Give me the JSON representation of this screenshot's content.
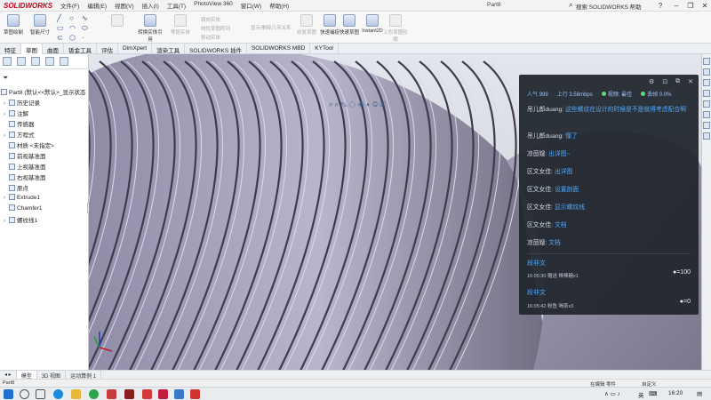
{
  "app": {
    "brand": "SOLIDWORKS",
    "title": "Part8",
    "help_search": "搜索 SOLIDWORKS 帮助",
    "menus": [
      "文件(F)",
      "编辑(E)",
      "视图(V)",
      "插入(I)",
      "工具(T)",
      "PhotoView 360",
      "窗口(W)",
      "帮助(H)"
    ]
  },
  "toolbar": {
    "sketch": "草图绘制",
    "smart_dim": "智能尺寸",
    "mirror": "镜向实体",
    "convert": "转换实体引用",
    "offset": "等距实体",
    "linear": "线性草图阵列",
    "move": "移动实体",
    "show": "显示/删除几何关系",
    "repair": "修复草图",
    "quick_snap": "快速捕捉",
    "rapid_sketch": "快速草图",
    "instant2d": "Instant2D",
    "shaded": "上色草图轮廓"
  },
  "command_tabs": [
    "特征",
    "草图",
    "曲面",
    "钣金工具",
    "评估",
    "DimXpert",
    "渲染工具",
    "SOLIDWORKS 插件",
    "SOLIDWORKS MBD",
    "KYTool"
  ],
  "tree": {
    "root": "Part8 (默认<<默认>_显示状态",
    "items": [
      "历史记录",
      "注解",
      "传感器",
      "方程式",
      "材质 <未指定>",
      "前视基准面",
      "上视基准面",
      "右视基准面",
      "原点",
      "Extrude1",
      "Chamfer1",
      "螺纹线1"
    ]
  },
  "chat": {
    "stats": {
      "popularity_label": "人气",
      "popularity": "999",
      "upload_label": "上行",
      "upload": "3.58mbps",
      "video_label": "视频: 最佳",
      "loss_label": "丢帧 0.0%"
    },
    "messages": [
      {
        "nick": "吊儿郎duang:",
        "text": "这些螺纹在设计的时候是不是就得考虑配合啊"
      },
      {
        "nick": "吊儿郎duang:",
        "text": "懂了"
      },
      {
        "nick": "凉茴嫂:",
        "text": "出详图~"
      },
      {
        "nick": "区文女佳:",
        "text": "出详图"
      },
      {
        "nick": "区文女佳:",
        "text": "设置剖面"
      },
      {
        "nick": "区文女佳:",
        "text": "显示螺纹线"
      },
      {
        "nick": "区文女佳:",
        "text": "文档"
      },
      {
        "nick": "凉茴嫂:",
        "text": "文档"
      }
    ],
    "gifts": [
      {
        "user": "段非文",
        "time": "16:05:30",
        "action": "赠送",
        "item": "棒棒糖x1",
        "count": "=100"
      },
      {
        "user": "段非文",
        "time": "16:05:42",
        "action": "粉鱼",
        "item": "喝茶x3",
        "count": "=0"
      }
    ]
  },
  "bottom_tabs": [
    "模型",
    "3D 视图",
    "运动算例 1"
  ],
  "status": {
    "left": "Part8",
    "editing": "在编辑 零件",
    "custom": "自定义"
  },
  "taskbar": {
    "ime": "英",
    "time": "16:20"
  },
  "colors": {
    "accent_link": "#4ea8ff",
    "chat_bg": "#21262e",
    "brand_red": "#d0021b",
    "thread_face": "#b7b4c9",
    "thread_dark": "#4a4758"
  }
}
